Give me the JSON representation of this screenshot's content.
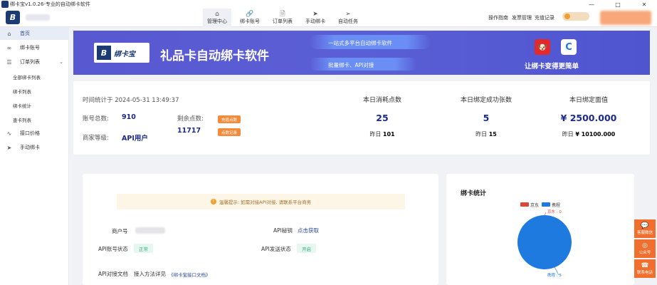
{
  "window": {
    "title": "绑卡宝v1.0.26-专业的自动绑卡软件",
    "controls": {
      "minimize": "—",
      "maximize": "□",
      "close": "✕"
    }
  },
  "nav": [
    {
      "label": "管理中心",
      "icon": "home-icon",
      "glyph": "⌂"
    },
    {
      "label": "绑卡账号",
      "icon": "link-icon",
      "glyph": "🔗"
    },
    {
      "label": "订单列表",
      "icon": "document-icon",
      "glyph": "🗎"
    },
    {
      "label": "手动绑卡",
      "icon": "send-icon",
      "glyph": "➤"
    },
    {
      "label": "自动任务",
      "icon": "paper-plane-icon",
      "glyph": "➢"
    }
  ],
  "header_links": {
    "guide": "操作指南",
    "tickets": "发票管理",
    "recharge": "充值记录"
  },
  "sidebar": {
    "items": [
      {
        "label": "首页",
        "icon": "home-icon",
        "glyph": "⌂"
      },
      {
        "label": "绑卡账号",
        "icon": "link-icon",
        "glyph": "∞"
      },
      {
        "label": "订单列表",
        "icon": "list-icon",
        "glyph": "☰"
      },
      {
        "label": "接口价格",
        "icon": "pulse-icon",
        "glyph": "∿"
      },
      {
        "label": "手动绑卡",
        "icon": "send-icon",
        "glyph": "➤"
      }
    ],
    "sub_items": [
      "全部绑卡列表",
      "绑卡列表",
      "绑卡统计",
      "查卡列表"
    ]
  },
  "banner": {
    "logo_text": "绑卡宝",
    "title": "礼品卡自动绑卡软件",
    "slogan1": "一站式多平台自动绑卡软件",
    "slogan2": "批量绑卡、API对接",
    "tagline": "让绑卡变得更简单"
  },
  "stats": {
    "time_label": "时间统计于 2024-05-31 13:49:37",
    "accounts_label": "账号总数:",
    "accounts_value": "910",
    "points_label": "剩余点数:",
    "points_value": "11717",
    "recharge_btn": "充值点数",
    "points_log_btn": "点数记录",
    "level_label": "商家等级:",
    "level_value": "API用户",
    "columns": [
      {
        "title": "本日消耗点数",
        "value": "25",
        "yesterday_label": "昨日",
        "yesterday_value": "101"
      },
      {
        "title": "本日绑定成功张数",
        "value": "5",
        "yesterday_label": "昨日",
        "yesterday_value": "15"
      },
      {
        "title": "本日绑定面值",
        "value": "¥ 2500.000",
        "yesterday_label": "昨日",
        "yesterday_value": "¥ 10100.000"
      }
    ]
  },
  "api": {
    "tip": "温馨提示: 如需对接API对接, 请联系平台商务",
    "merchant_label": "商户号",
    "secret_label": "API秘钥",
    "secret_action": "点击获取",
    "account_status_label": "API账号状态",
    "account_status_value": "正常",
    "send_status_label": "API发送状态",
    "send_status_value": "开启",
    "doc_label": "API对接文档",
    "doc_hint": "接入方法详见",
    "doc_link": "《绑卡宝接口文档》"
  },
  "chart_data": {
    "type": "pie",
    "title": "绑卡统计",
    "categories": [
      "京东",
      "携程"
    ],
    "values": [
      0,
      5
    ],
    "colors": [
      "#d64a3b",
      "#1f7ae0"
    ],
    "legend_position": "top",
    "data_labels": [
      "京东 : 0",
      "携程 : 5"
    ]
  },
  "float_tools": [
    {
      "label": "客服微信",
      "icon": "wechat-icon",
      "glyph": "💬"
    },
    {
      "label": "公众号",
      "icon": "official-account-icon",
      "glyph": "◎"
    },
    {
      "label": "联系电话",
      "icon": "phone-icon",
      "glyph": "☎"
    }
  ]
}
